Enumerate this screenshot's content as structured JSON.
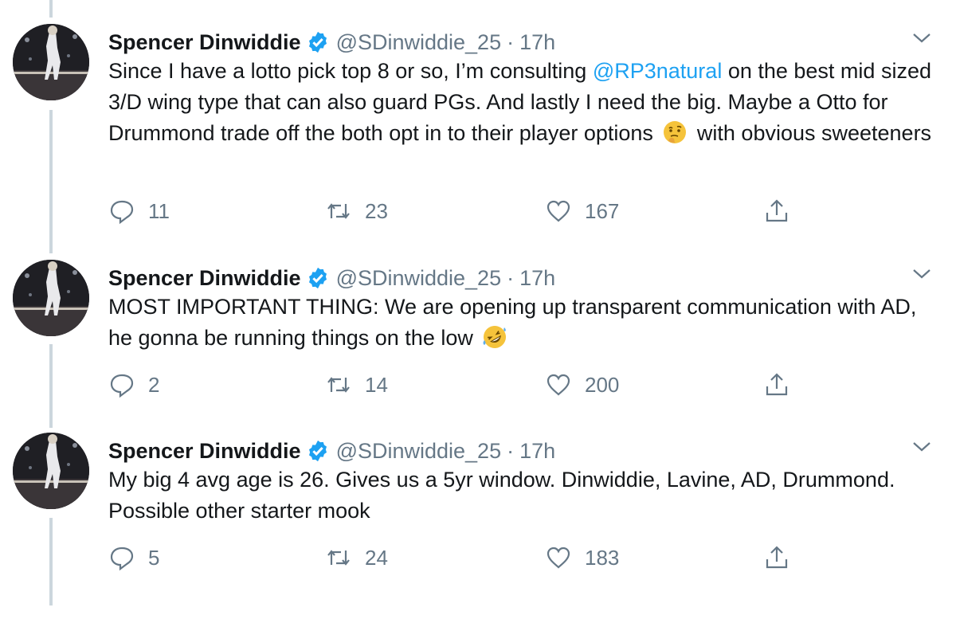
{
  "tweets": [
    {
      "name": "Spencer Dinwiddie",
      "handle": "@SDinwiddie_25",
      "separator": "·",
      "time": "17h",
      "text_parts": [
        "Since I have a lotto pick top 8 or so, I’m consulting ",
        "@RP3natural",
        " on the best mid sized 3/D wing type that can also guard PGs. And lastly I need the big. Maybe a Otto for Drummond trade off the both opt in to their player options ",
        " with obvious sweeteners"
      ],
      "emoji": "thinking-face",
      "replies": "11",
      "retweets": "23",
      "likes": "167"
    },
    {
      "name": "Spencer Dinwiddie",
      "handle": "@SDinwiddie_25",
      "separator": "·",
      "time": "17h",
      "text_parts": [
        "MOST IMPORTANT THING: We are opening up transparent communication with AD, he gonna be running things on the low "
      ],
      "emoji": "rolling-on-floor-laughing",
      "replies": "2",
      "retweets": "14",
      "likes": "200"
    },
    {
      "name": "Spencer Dinwiddie",
      "handle": "@SDinwiddie_25",
      "separator": "·",
      "time": "17h",
      "text_parts": [
        "My big 4 avg age is 26. Gives us a 5yr window. Dinwiddie, Lavine, AD, Drummond. Possible other starter mook"
      ],
      "replies": "5",
      "retweets": "24",
      "likes": "183"
    }
  ],
  "colors": {
    "text": "#14171a",
    "secondary": "#657786",
    "accent": "#1da1f2",
    "verified": "#1da1f2",
    "thread_line": "#ccd6dd"
  }
}
